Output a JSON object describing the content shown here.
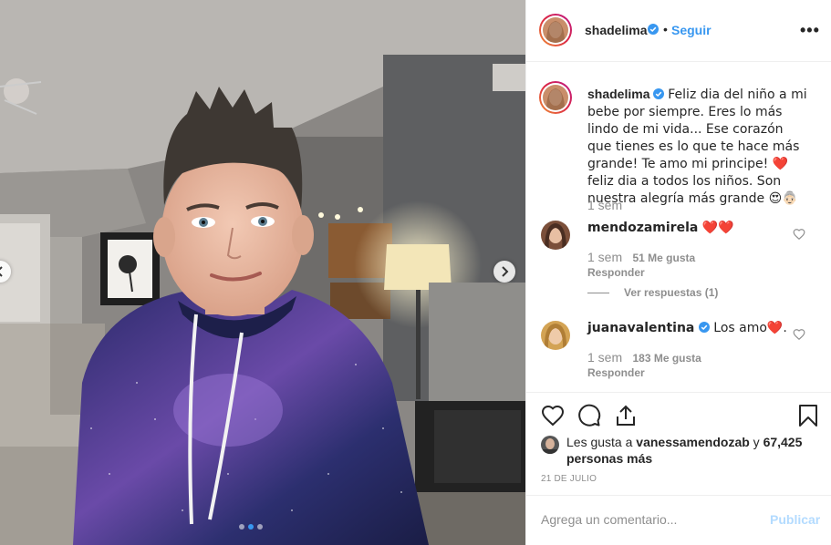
{
  "post": {
    "username": "shadelima",
    "follow_label": "Seguir",
    "separator": "•",
    "more_label": "•••",
    "caption": "Feliz dia del niño a mi bebe por siempre. Eres lo más lindo de mi vida... Ese corazón que tienes es lo que te hace más grande! Te amo mi principe! ❤️ feliz dia a todos los niños. Son nuestra alegría más grande 😍👵🏻",
    "caption_time": "1 sem"
  },
  "comments": [
    {
      "username": "mendozamirela",
      "text": "❤️❤️",
      "time": "1 sem",
      "likes": "51 Me gusta",
      "reply_label": "Responder",
      "view_replies": "Ver respuestas (1)"
    },
    {
      "username": "juanavalentina",
      "text": "Los amo❤️.",
      "time": "1 sem",
      "likes": "183 Me gusta",
      "reply_label": "Responder"
    }
  ],
  "likes": {
    "prefix": "Les gusta a",
    "user": "vanessamendozab",
    "joiner": "y",
    "count": "67,425 personas más"
  },
  "date": "21 DE JULIO",
  "comment_box": {
    "placeholder": "Agrega un comentario...",
    "publish_label": "Publicar"
  },
  "carousel": {
    "total": 3,
    "active_index": 1
  },
  "colors": {
    "accent": "#3897f0",
    "heart": "#ed4956",
    "publish_disabled": "#b3dbff"
  }
}
